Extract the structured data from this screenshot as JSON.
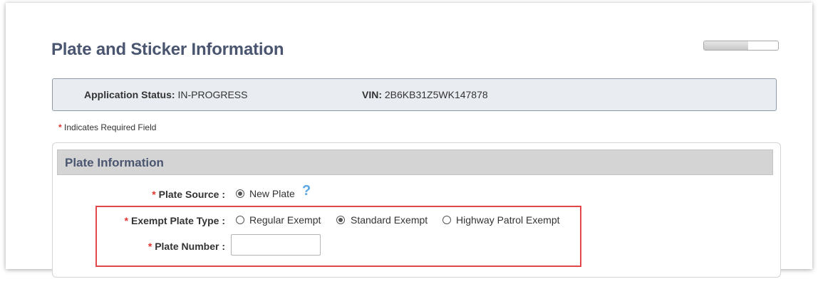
{
  "page": {
    "title": "Plate and Sticker Information",
    "progress_fraction": 0.6
  },
  "status": {
    "app_status_label": "Application Status:",
    "app_status_value": "IN-PROGRESS",
    "vin_label": "VIN:",
    "vin_value": "2B6KB31Z5WK147878"
  },
  "required_note": {
    "star": "*",
    "text": "Indicates Required Field"
  },
  "plate_info": {
    "header": "Plate Information",
    "plate_source": {
      "label": "Plate Source :",
      "options": [
        {
          "label": "New Plate",
          "checked": true
        }
      ]
    },
    "exempt_plate_type": {
      "label": "Exempt Plate Type :",
      "options": [
        {
          "label": "Regular Exempt",
          "checked": false
        },
        {
          "label": "Standard Exempt",
          "checked": true
        },
        {
          "label": "Highway Patrol Exempt",
          "checked": false
        }
      ]
    },
    "plate_number": {
      "label": "Plate Number :",
      "value": "",
      "placeholder": ""
    }
  },
  "icons": {
    "help": "question-mark-icon",
    "required": "asterisk-icon"
  },
  "colors": {
    "required_star": "#e0342d",
    "highlight_border": "#e0484c",
    "title_text": "#4a5570",
    "help_icon": "#5aa8e6"
  }
}
